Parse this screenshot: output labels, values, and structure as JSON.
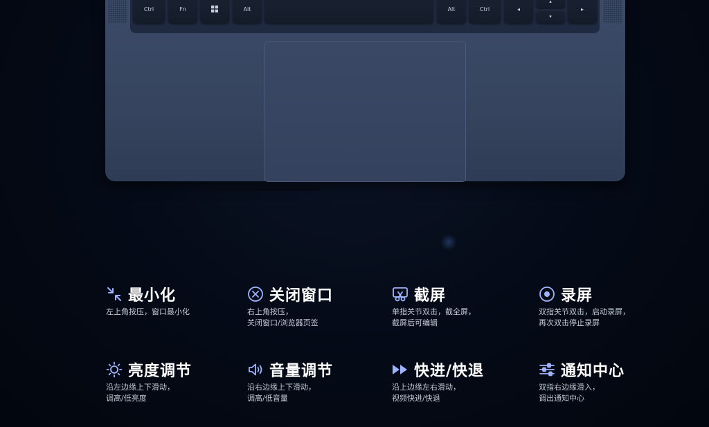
{
  "keyboard": {
    "keys": [
      "Ctrl",
      "Fn",
      "",
      "Alt",
      "",
      "Alt",
      "Ctrl",
      "◂",
      "▴",
      "▾",
      "▸"
    ]
  },
  "features": [
    {
      "icon": "minimize-icon",
      "title": "最小化",
      "desc": [
        "左上角按压，窗口最小化"
      ]
    },
    {
      "icon": "close-circle-icon",
      "title": "关闭窗口",
      "desc": [
        "右上角按压，",
        "关闭窗口/浏览器页签"
      ]
    },
    {
      "icon": "screenshot-scissors-icon",
      "title": "截屏",
      "desc": [
        "单指关节双击，截全屏，",
        "截屏后可编辑"
      ]
    },
    {
      "icon": "record-icon",
      "title": "录屏",
      "desc": [
        "双指关节双击，启动录屏，",
        "再次双击停止录屏"
      ]
    },
    {
      "icon": "brightness-sun-icon",
      "title": "亮度调节",
      "desc": [
        "沿左边缘上下滑动，",
        "调高/低亮度"
      ]
    },
    {
      "icon": "volume-speaker-icon",
      "title": "音量调节",
      "desc": [
        "沿右边缘上下滑动，",
        "调高/低音量"
      ]
    },
    {
      "icon": "fast-forward-icon",
      "title": "快进/快退",
      "desc": [
        "沿上边缘左右滑动，",
        "视频快进/快退"
      ]
    },
    {
      "icon": "sliders-icon",
      "title": "通知中心",
      "desc": [
        "双指右边缘滑入，",
        "调出通知中心"
      ]
    }
  ],
  "colors": {
    "accent": "#9fb4ff",
    "background": "#030814",
    "deck": "#36445f"
  }
}
